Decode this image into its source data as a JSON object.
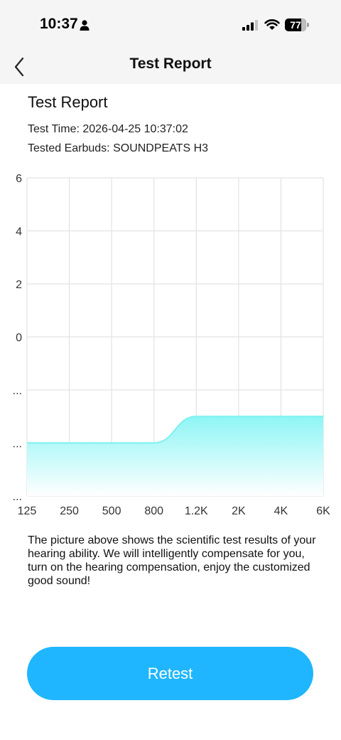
{
  "status_bar": {
    "time": "10:37",
    "battery_level": "77",
    "battery_fraction": 0.77,
    "icons": [
      "person-icon",
      "cellular-signal-icon",
      "wifi-icon",
      "battery-icon"
    ]
  },
  "nav": {
    "title": "Test Report",
    "back_icon": "chevron-left-icon"
  },
  "report": {
    "title": "Test Report",
    "test_time": "Test Time: 2026-04-25 10:37:02",
    "tested_earbuds": "Tested Earbuds: SOUNDPEATS H3",
    "description": "The picture above shows the scientific test results of your hearing ability. We will intelligently compensate for you, turn on the hearing compensation, enjoy the customized good sound!"
  },
  "chart_data": {
    "type": "area",
    "x_ticks": [
      "125",
      "250",
      "500",
      "800",
      "1.2K",
      "2K",
      "4K",
      "6K"
    ],
    "y_ticks": [
      "6",
      "4",
      "2",
      "0",
      "...",
      "...",
      "..."
    ],
    "y_tick_values": [
      6,
      4,
      2,
      0,
      -2,
      -4,
      -6
    ],
    "ylim": [
      -6,
      6
    ],
    "values": [
      -4,
      -4,
      -4,
      -4,
      -3,
      -3,
      -3,
      -3
    ],
    "grid": true,
    "colors": {
      "line": "#7ff0f0",
      "fill_top": "#8ef5f5",
      "fill_bottom": "#ffffff",
      "grid": "#e3e3e3",
      "tick_label": "#333333"
    }
  },
  "actions": {
    "retest_label": "Retest"
  }
}
